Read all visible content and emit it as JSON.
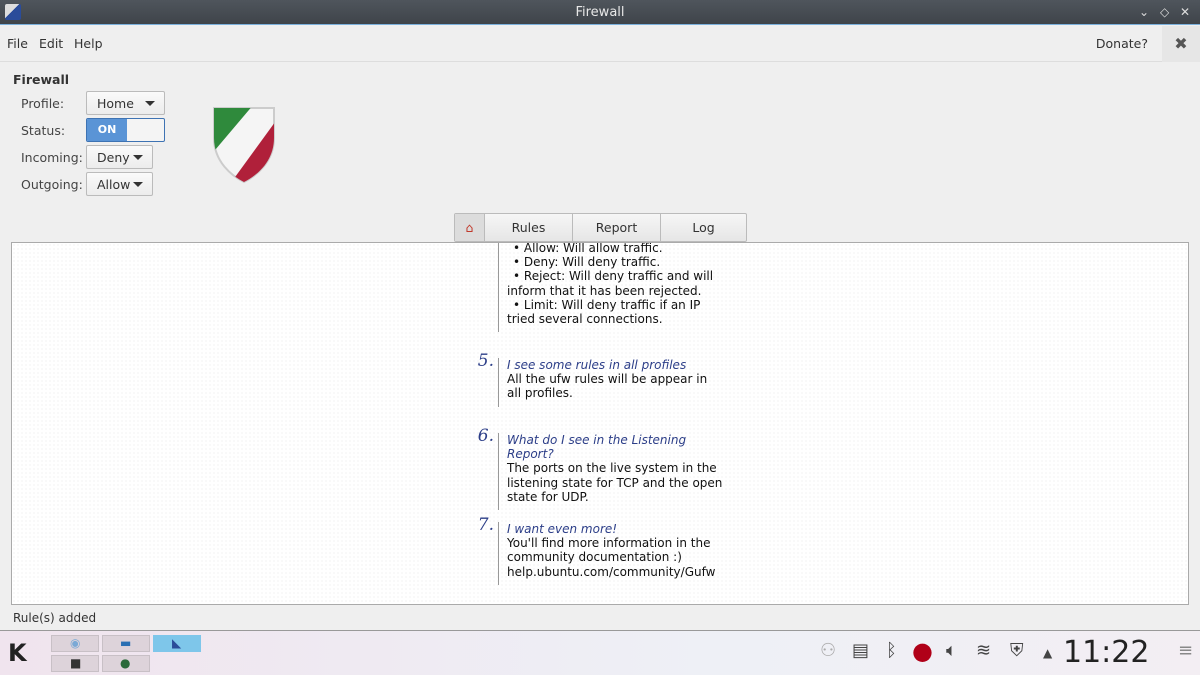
{
  "window": {
    "title": "Firewall"
  },
  "menu": {
    "items": [
      "File",
      "Edit",
      "Help"
    ],
    "donate": "Donate?"
  },
  "firewall": {
    "heading": "Firewall",
    "profile_label": "Profile:",
    "profile_value": "Home",
    "status_label": "Status:",
    "status_value": "ON",
    "incoming_label": "Incoming:",
    "incoming_value": "Deny",
    "outgoing_label": "Outgoing:",
    "outgoing_value": "Allow"
  },
  "tabs": [
    "Rules",
    "Report",
    "Log"
  ],
  "faq": {
    "partial_lines": [
      "• Allow: Will allow traffic.",
      "• Deny: Will deny traffic.",
      "• Reject: Will deny traffic and will inform that it has been rejected.",
      "• Limit: Will deny traffic if an IP tried several connections."
    ],
    "items": [
      {
        "num": "5.",
        "q": "I see some rules in all profiles",
        "a": "All the ufw rules will be appear in all profiles."
      },
      {
        "num": "6.",
        "q": "What do I see in the Listening Report?",
        "a": "The ports on the live system in the listening state for TCP and the open state for UDP."
      },
      {
        "num": "7.",
        "q": "I want even more!",
        "a": "You'll find more information in the community documentation :) help.ubuntu.com/community/Gufw"
      }
    ]
  },
  "statusbar": {
    "text": "Rule(s) added"
  },
  "taskbar": {
    "clock": "11:22",
    "tray_icons": [
      "user-icon",
      "clipboard-icon",
      "bluetooth-icon",
      "record-icon",
      "volume-icon",
      "wifi-icon",
      "firewall-shield-icon",
      "expand-arrow-icon"
    ]
  },
  "colors": {
    "accent": "#5a94d6",
    "faq_heading": "#2c3e88"
  }
}
